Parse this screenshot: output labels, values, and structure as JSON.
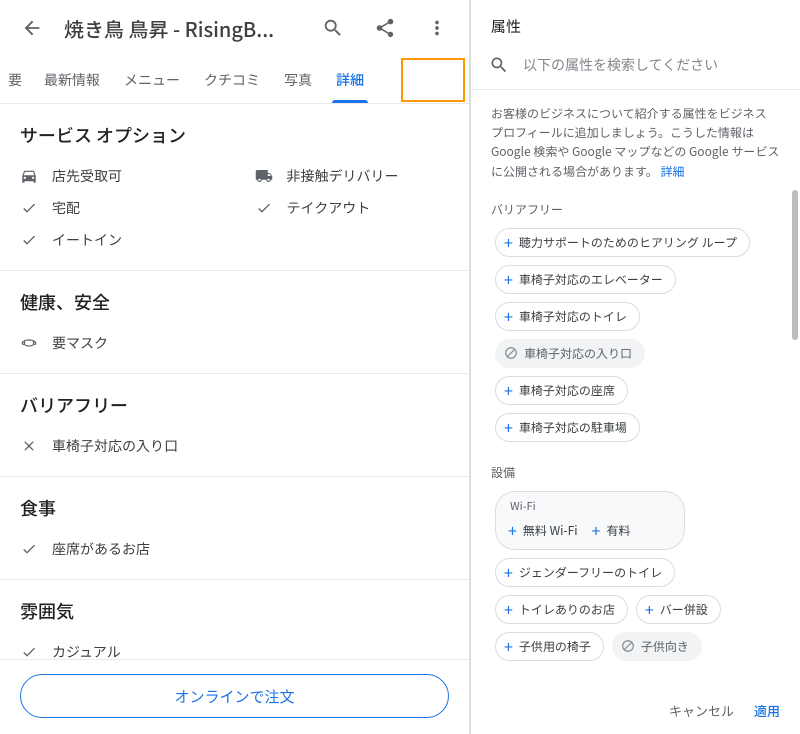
{
  "header": {
    "title": "焼き鳥 鳥昇 - RisingB..."
  },
  "tabs": {
    "overview_partial": "要",
    "latest": "最新情報",
    "menu": "メニュー",
    "reviews": "クチコミ",
    "photos": "写真",
    "details": "詳細"
  },
  "sections": {
    "service": {
      "title": "サービス オプション",
      "items": {
        "curbside": "店先受取可",
        "noContactDelivery": "非接触デリバリー",
        "delivery": "宅配",
        "takeout": "テイクアウト",
        "dineIn": "イートイン"
      }
    },
    "health": {
      "title": "健康、安全",
      "mask": "要マスク"
    },
    "accessibility": {
      "title": "バリアフリー",
      "wheelchairEntrance": "車椅子対応の入り口"
    },
    "dining": {
      "title": "食事",
      "seating": "座席があるお店"
    },
    "atmosphere": {
      "title": "雰囲気",
      "casual": "カジュアル"
    }
  },
  "orderButton": "オンラインで注文",
  "right": {
    "title": "属性",
    "searchPlaceholder": "以下の属性を検索してください",
    "description": "お客様のビジネスについて紹介する属性をビジネス プロフィールに追加しましょう。こうした情報は Google 検索や Google マップなどの Google サービスに公開される場合があります。",
    "detailsLink": "詳細",
    "groups": {
      "accessibility": {
        "title": "バリアフリー",
        "hearingLoop": "聴力サポートのためのヒアリング ループ",
        "elevator": "車椅子対応のエレベーター",
        "toilet": "車椅子対応のトイレ",
        "entrance": "車椅子対応の入り口",
        "seating": "車椅子対応の座席",
        "parking": "車椅子対応の駐車場"
      },
      "amenities": {
        "title": "設備",
        "wifiLabel": "Wi-Fi",
        "wifiFree": "無料 Wi-Fi",
        "wifiPaid": "有料",
        "genderFreeToilet": "ジェンダーフリーのトイレ",
        "hasToilet": "トイレありのお店",
        "bar": "バー併設",
        "kidsChair": "子供用の椅子",
        "goodForKids": "子供向き"
      }
    },
    "cancel": "キャンセル",
    "apply": "適用"
  }
}
